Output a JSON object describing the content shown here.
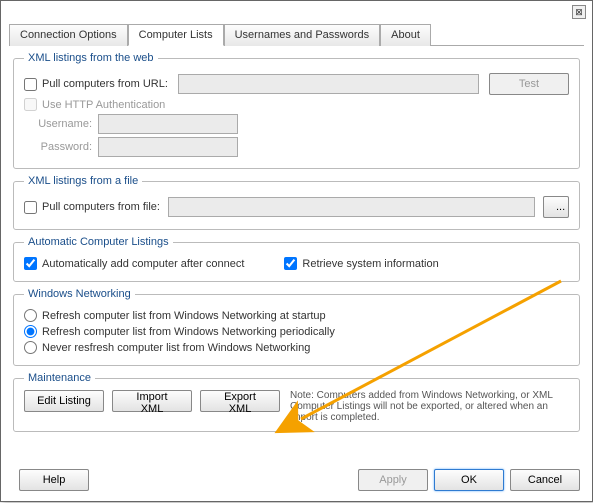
{
  "tabs": {
    "connection": "Connection Options",
    "computer": "Computer Lists",
    "usernames": "Usernames and Passwords",
    "about": "About"
  },
  "xml_web": {
    "legend": "XML listings from the web",
    "pull_url": "Pull computers from URL:",
    "test": "Test",
    "http_auth": "Use HTTP Authentication",
    "username": "Username:",
    "password": "Password:"
  },
  "xml_file": {
    "legend": "XML listings from a file",
    "pull_file": "Pull computers from file:",
    "browse": "..."
  },
  "auto": {
    "legend": "Automatic Computer Listings",
    "add_after": "Automatically add computer after connect",
    "retrieve": "Retrieve system information"
  },
  "winnet": {
    "legend": "Windows Networking",
    "startup": "Refresh computer list from Windows Networking at startup",
    "periodic": "Refresh computer list from Windows Networking periodically",
    "never": "Never resfresh computer list from Windows Networking"
  },
  "maint": {
    "legend": "Maintenance",
    "edit": "Edit Listing",
    "import": "Import XML",
    "export": "Export XML",
    "note": "Note: Computers added from Windows Networking, or XML Computer Listings will not be exported, or altered when an import is completed."
  },
  "footer": {
    "help": "Help",
    "apply": "Apply",
    "ok": "OK",
    "cancel": "Cancel"
  },
  "close": "⊠"
}
